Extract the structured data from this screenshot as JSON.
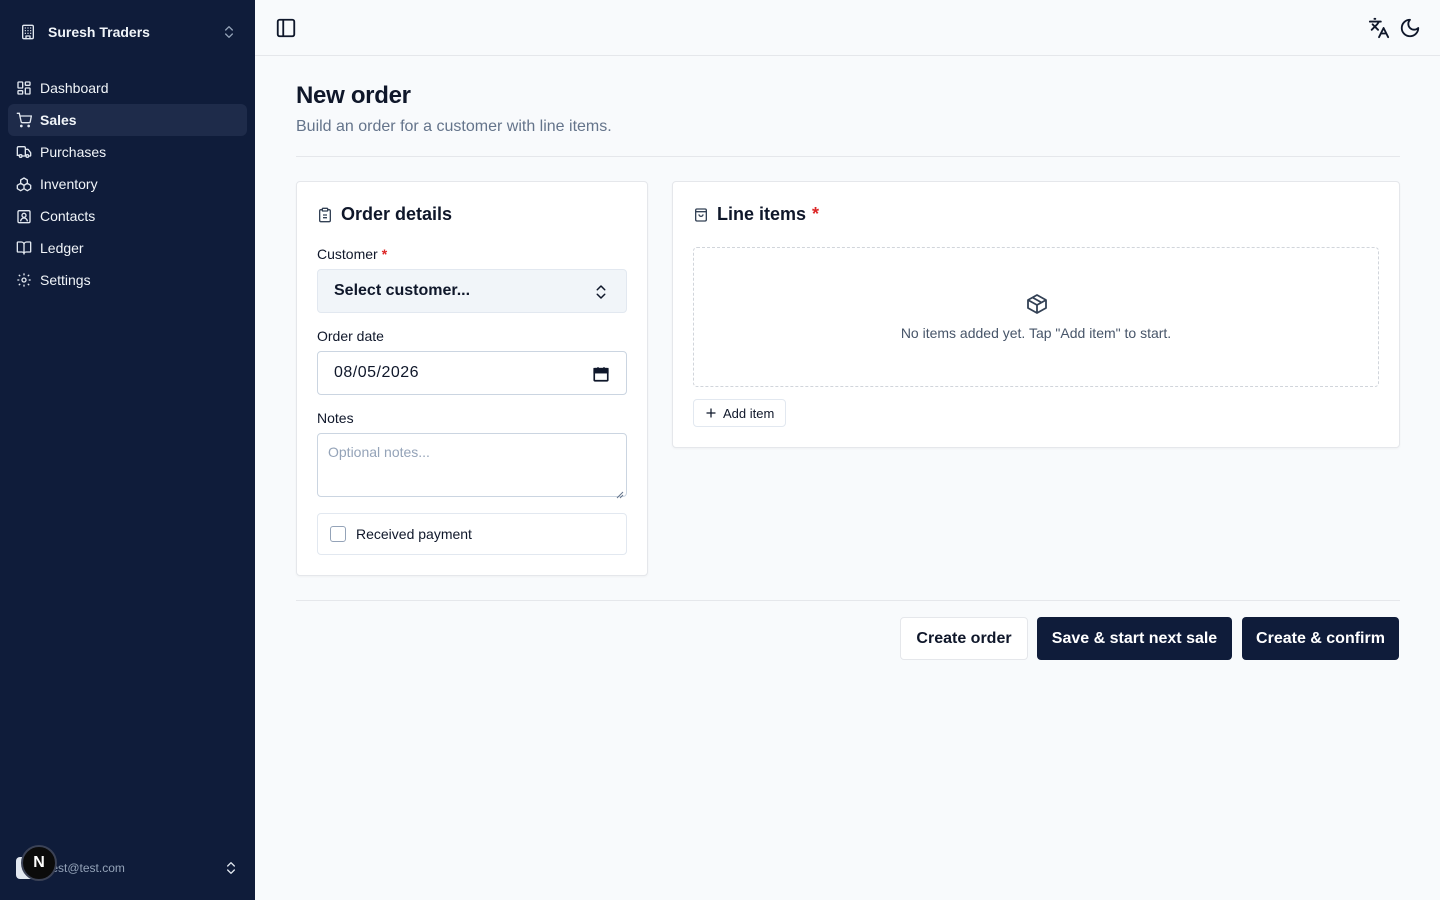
{
  "sidebar": {
    "org_name": "Suresh Traders",
    "items": [
      {
        "label": "Dashboard",
        "icon": "dashboard-icon"
      },
      {
        "label": "Sales",
        "icon": "cart-icon",
        "active": true
      },
      {
        "label": "Purchases",
        "icon": "truck-icon"
      },
      {
        "label": "Inventory",
        "icon": "boxes-icon"
      },
      {
        "label": "Contacts",
        "icon": "contacts-icon"
      },
      {
        "label": "Ledger",
        "icon": "book-icon"
      },
      {
        "label": "Settings",
        "icon": "gear-icon"
      }
    ],
    "user_email": "test@test.com",
    "badge_letter": "N"
  },
  "header": {
    "title": "New order",
    "subtitle": "Build an order for a customer with line items."
  },
  "order_details": {
    "title": "Order details",
    "customer_label": "Customer",
    "required_mark": "*",
    "customer_value": "Select customer...",
    "date_label": "Order date",
    "date_value": "08/05/2026",
    "notes_label": "Notes",
    "notes_placeholder": "Optional notes...",
    "payment_label": "Received payment"
  },
  "line_items": {
    "title": "Line items",
    "required_mark": "*",
    "empty_message": "No items added yet. Tap \"Add item\" to start.",
    "add_label": "Add item"
  },
  "actions": {
    "create": "Create order",
    "save_next": "Save & start next sale",
    "create_confirm": "Create & confirm"
  },
  "colors": {
    "sidebar_bg": "#0f1c3a",
    "primary": "#0f1c3a",
    "required": "#dc2626"
  }
}
